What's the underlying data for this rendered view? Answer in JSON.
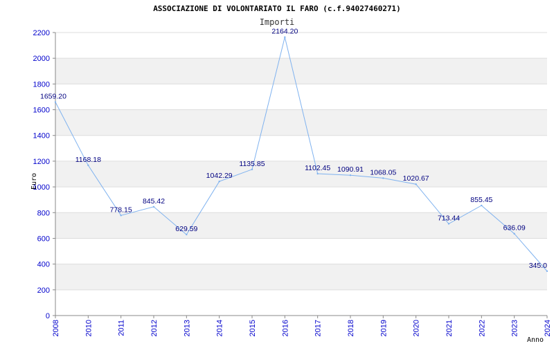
{
  "chart_data": {
    "type": "line",
    "title": "ASSOCIAZIONE DI VOLONTARIATO IL FARO (c.f.94027460271)",
    "subtitle": "Importi",
    "xlabel": "Anno",
    "ylabel": "Euro",
    "ylim": [
      0,
      2200
    ],
    "yticks": [
      0,
      200,
      400,
      600,
      800,
      1000,
      1200,
      1400,
      1600,
      1800,
      2000,
      2200
    ],
    "grid": true,
    "x": [
      2008,
      2010,
      2011,
      2012,
      2013,
      2014,
      2015,
      2016,
      2017,
      2018,
      2019,
      2020,
      2021,
      2022,
      2023,
      2024
    ],
    "series": [
      {
        "values": [
          1659.2,
          1168.18,
          778.15,
          845.42,
          629.59,
          1042.29,
          1135.85,
          2164.2,
          1102.45,
          1090.91,
          1068.05,
          1020.67,
          713.44,
          855.45,
          636.09,
          345.0
        ],
        "labels": [
          "1659.20",
          "1168.18",
          "778.15",
          "845.42",
          "629.59",
          "1042.29",
          "1135.85",
          "2164.20",
          "1102.45",
          "1090.91",
          "1068.05",
          "1020.67",
          "713.44",
          "855.45",
          "636.09",
          "345.0"
        ]
      }
    ],
    "colors": {
      "line": "#7fb2ef",
      "tick_text": "#0000cc",
      "label_text": "#000080",
      "band": "#f1f1f1",
      "grid": "#dddddd",
      "axis": "#888888"
    }
  }
}
